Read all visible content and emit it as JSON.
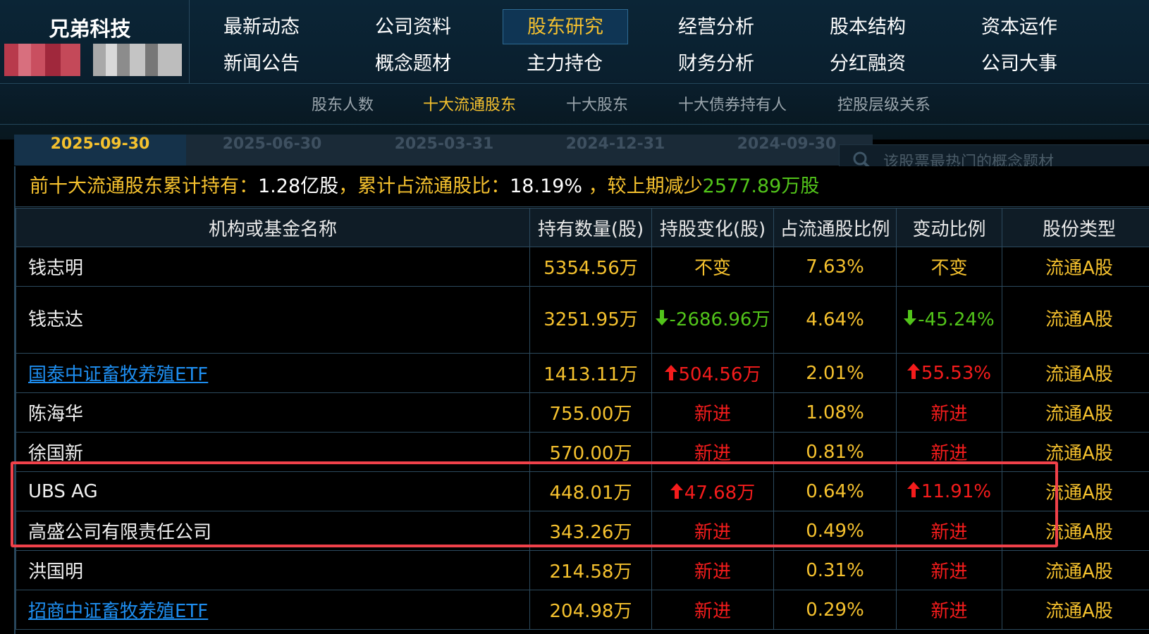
{
  "header": {
    "company_name": "兄弟科技",
    "nav_row1": [
      "最新动态",
      "公司资料",
      "股东研究",
      "经营分析",
      "股本结构",
      "资本运作"
    ],
    "nav_row2": [
      "新闻公告",
      "概念题材",
      "主力持仓",
      "财务分析",
      "分红融资",
      "公司大事"
    ],
    "active_nav": "股东研究",
    "sub_nav": [
      "股东人数",
      "十大流通股东",
      "十大股东",
      "十大债券持有人",
      "控股层级关系"
    ],
    "active_sub": "十大流通股东"
  },
  "date_tabs": [
    "2025-09-30",
    "2025-06-30",
    "2025-03-31",
    "2024-12-31",
    "2024-09-30"
  ],
  "search": {
    "placeholder": "该股票最热门的概念题材"
  },
  "summary": {
    "label1": "前十大流通股东累计持有：",
    "value1": "1.28亿股",
    "label2": "，累计占流通股比：",
    "value2": "18.19%",
    "label3": " ，较上期减少",
    "value3": "2577.89万股"
  },
  "table": {
    "headers": [
      "机构或基金名称",
      "持有数量(股)",
      "持股变化(股)",
      "占流通股比例",
      "变动比例",
      "股份类型"
    ],
    "rows": [
      {
        "name": "钱志明",
        "link": false,
        "holding": "5354.56万",
        "change": "不变",
        "change_dir": "none",
        "ratio": "7.63%",
        "change_pct": "不变",
        "type": "流通A股"
      },
      {
        "name": "钱志达",
        "link": false,
        "holding": "3251.95万",
        "change": "-2686.96万",
        "change_dir": "down",
        "ratio": "4.64%",
        "change_pct": "-45.24%",
        "type": "流通A股"
      },
      {
        "name": "国泰中证畜牧养殖ETF",
        "link": true,
        "holding": "1413.11万",
        "change": "504.56万",
        "change_dir": "up",
        "ratio": "2.01%",
        "change_pct": "55.53%",
        "type": "流通A股"
      },
      {
        "name": "陈海华",
        "link": false,
        "holding": "755.00万",
        "change": "新进",
        "change_dir": "new",
        "ratio": "1.08%",
        "change_pct": "新进",
        "type": "流通A股"
      },
      {
        "name": "徐国新",
        "link": false,
        "holding": "570.00万",
        "change": "新进",
        "change_dir": "new",
        "ratio": "0.81%",
        "change_pct": "新进",
        "type": "流通A股"
      },
      {
        "name": "UBS AG",
        "link": false,
        "holding": "448.01万",
        "change": "47.68万",
        "change_dir": "up",
        "ratio": "0.64%",
        "change_pct": "11.91%",
        "type": "流通A股"
      },
      {
        "name": "高盛公司有限责任公司",
        "link": false,
        "holding": "343.26万",
        "change": "新进",
        "change_dir": "new",
        "ratio": "0.49%",
        "change_pct": "新进",
        "type": "流通A股"
      },
      {
        "name": "洪国明",
        "link": false,
        "holding": "214.58万",
        "change": "新进",
        "change_dir": "new",
        "ratio": "0.31%",
        "change_pct": "新进",
        "type": "流通A股"
      },
      {
        "name": "招商中证畜牧养殖ETF",
        "link": true,
        "holding": "204.98万",
        "change": "新进",
        "change_dir": "new",
        "ratio": "0.29%",
        "change_pct": "新进",
        "type": "流通A股"
      }
    ]
  },
  "colors": {
    "accent": "#f5c12e",
    "up": "#f51c1c",
    "down": "#52c41a",
    "link": "#1e8ef0",
    "highlight_box": "#f0414a"
  }
}
